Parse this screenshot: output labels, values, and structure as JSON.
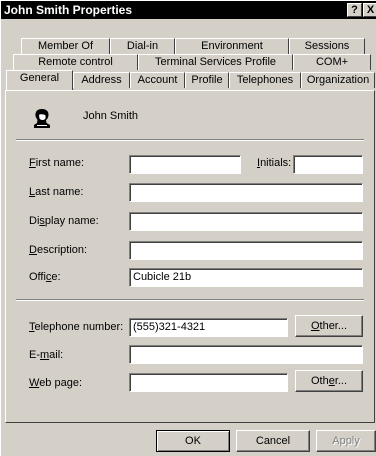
{
  "window": {
    "title": "John Smith Properties",
    "help_glyph": "?",
    "close_glyph": "X"
  },
  "tabs": {
    "row1": [
      "Member Of",
      "Dial-in",
      "Environment",
      "Sessions"
    ],
    "row2": [
      "Remote control",
      "Terminal Services Profile",
      "COM+"
    ],
    "row3": [
      "General",
      "Address",
      "Account",
      "Profile",
      "Telephones",
      "Organization"
    ],
    "selected": "General"
  },
  "general": {
    "display_user": "John Smith",
    "first_name": {
      "prefix": "",
      "accel": "F",
      "rest": "irst name:",
      "value": ""
    },
    "initials": {
      "prefix": "",
      "accel": "I",
      "rest": "nitials:",
      "value": ""
    },
    "last_name": {
      "prefix": "",
      "accel": "L",
      "rest": "ast name:",
      "value": ""
    },
    "display_name": {
      "prefix": "Di",
      "accel": "s",
      "rest": "play name:",
      "value": ""
    },
    "description": {
      "prefix": "",
      "accel": "D",
      "rest": "escription:",
      "value": ""
    },
    "office": {
      "prefix": "Offi",
      "accel": "c",
      "rest": "e:",
      "value": "Cubicle 21b"
    },
    "telephone": {
      "prefix": "",
      "accel": "T",
      "rest": "elephone number:",
      "value": "(555)321-4321"
    },
    "email": {
      "prefix": "E-",
      "accel": "m",
      "rest": "ail:",
      "value": ""
    },
    "web_page": {
      "prefix": "",
      "accel": "W",
      "rest": "eb page:",
      "value": ""
    },
    "other_phone_button": {
      "prefix": "",
      "accel": "O",
      "rest": "ther..."
    },
    "other_web_button": {
      "prefix": "Oth",
      "accel": "e",
      "rest": "r..."
    }
  },
  "buttons": {
    "ok": "OK",
    "cancel": "Cancel",
    "apply": "Apply"
  }
}
